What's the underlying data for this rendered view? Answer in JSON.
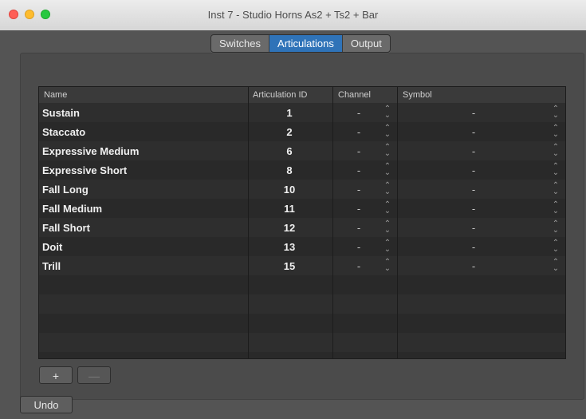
{
  "window": {
    "title": "Inst 7 - Studio Horns As2 + Ts2 + Bar"
  },
  "tabs": [
    {
      "label": "Switches",
      "active": false
    },
    {
      "label": "Articulations",
      "active": true
    },
    {
      "label": "Output",
      "active": false
    }
  ],
  "table": {
    "headers": {
      "name": "Name",
      "articulation_id": "Articulation ID",
      "channel": "Channel",
      "symbol": "Symbol"
    },
    "rows": [
      {
        "name": "Sustain",
        "articulation_id": "1",
        "channel": "-",
        "symbol": "-"
      },
      {
        "name": "Staccato",
        "articulation_id": "2",
        "channel": "-",
        "symbol": "-"
      },
      {
        "name": "Expressive Medium",
        "articulation_id": "6",
        "channel": "-",
        "symbol": "-"
      },
      {
        "name": "Expressive Short",
        "articulation_id": "8",
        "channel": "-",
        "symbol": "-"
      },
      {
        "name": "Fall Long",
        "articulation_id": "10",
        "channel": "-",
        "symbol": "-"
      },
      {
        "name": "Fall Medium",
        "articulation_id": "11",
        "channel": "-",
        "symbol": "-"
      },
      {
        "name": "Fall Short",
        "articulation_id": "12",
        "channel": "-",
        "symbol": "-"
      },
      {
        "name": "Doit",
        "articulation_id": "13",
        "channel": "-",
        "symbol": "-"
      },
      {
        "name": "Trill",
        "articulation_id": "15",
        "channel": "-",
        "symbol": "-"
      }
    ]
  },
  "buttons": {
    "add": "+",
    "remove": "—",
    "undo": "Undo"
  },
  "colors": {
    "accent": "#2f73b8",
    "close": "#fe5f57",
    "minimize": "#febc2e",
    "maximize": "#28c840"
  }
}
